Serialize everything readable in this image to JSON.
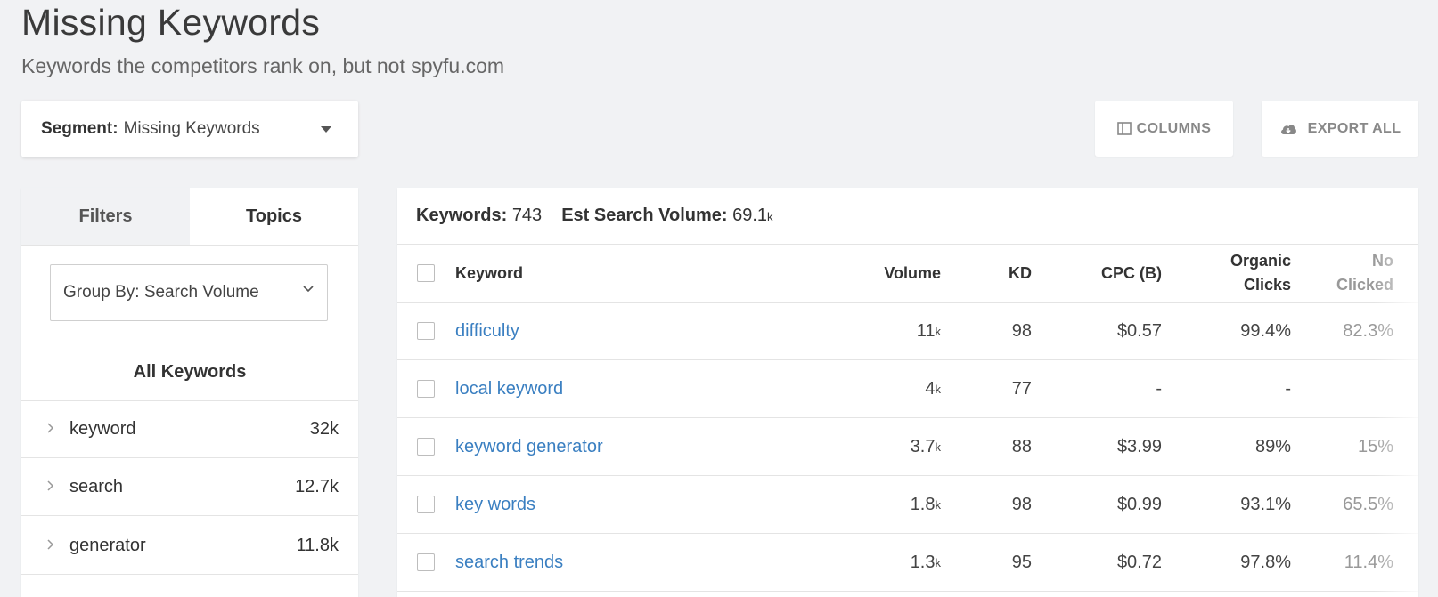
{
  "page": {
    "title": "Missing Keywords",
    "subtitle": "Keywords the competitors rank on, but not spyfu.com"
  },
  "segment": {
    "label": "Segment:",
    "value": "Missing Keywords"
  },
  "toolbar": {
    "columns_label": "COLUMNS",
    "export_label": "EXPORT ALL"
  },
  "sidebar": {
    "tabs": [
      {
        "label": "Filters",
        "active": false
      },
      {
        "label": "Topics",
        "active": true
      }
    ],
    "group_by": "Group By: Search Volume",
    "all_keywords": "All Keywords",
    "topics": [
      {
        "label": "keyword",
        "count": "32k"
      },
      {
        "label": "search",
        "count": "12.7k"
      },
      {
        "label": "generator",
        "count": "11.8k"
      }
    ]
  },
  "summary": {
    "keywords_label": "Keywords:",
    "keywords_value": "743",
    "volume_label": "Est Search Volume:",
    "volume_value": "69.1",
    "volume_unit": "k"
  },
  "table": {
    "headers": {
      "keyword": "Keyword",
      "volume": "Volume",
      "kd": "KD",
      "cpc": "CPC (B)",
      "organic_line1": "Organic",
      "organic_line2": "Clicks",
      "noclick_line1": "No",
      "noclick_line2": "Clicked"
    },
    "rows": [
      {
        "keyword": "difficulty",
        "volume": "11",
        "volume_unit": "k",
        "kd": "98",
        "cpc": "$0.57",
        "organic": "99.4%",
        "noclick": "82.3%"
      },
      {
        "keyword": "local keyword",
        "volume": "4",
        "volume_unit": "k",
        "kd": "77",
        "cpc": "-",
        "organic": "-",
        "noclick": ""
      },
      {
        "keyword": "keyword generator",
        "volume": "3.7",
        "volume_unit": "k",
        "kd": "88",
        "cpc": "$3.99",
        "organic": "89%",
        "noclick": "15%"
      },
      {
        "keyword": "key words",
        "volume": "1.8",
        "volume_unit": "k",
        "kd": "98",
        "cpc": "$0.99",
        "organic": "93.1%",
        "noclick": "65.5%"
      },
      {
        "keyword": "search trends",
        "volume": "1.3",
        "volume_unit": "k",
        "kd": "95",
        "cpc": "$0.72",
        "organic": "97.8%",
        "noclick": "11.4%"
      }
    ]
  },
  "colors": {
    "link": "#3a7fc1",
    "background": "#f1f2f4"
  }
}
